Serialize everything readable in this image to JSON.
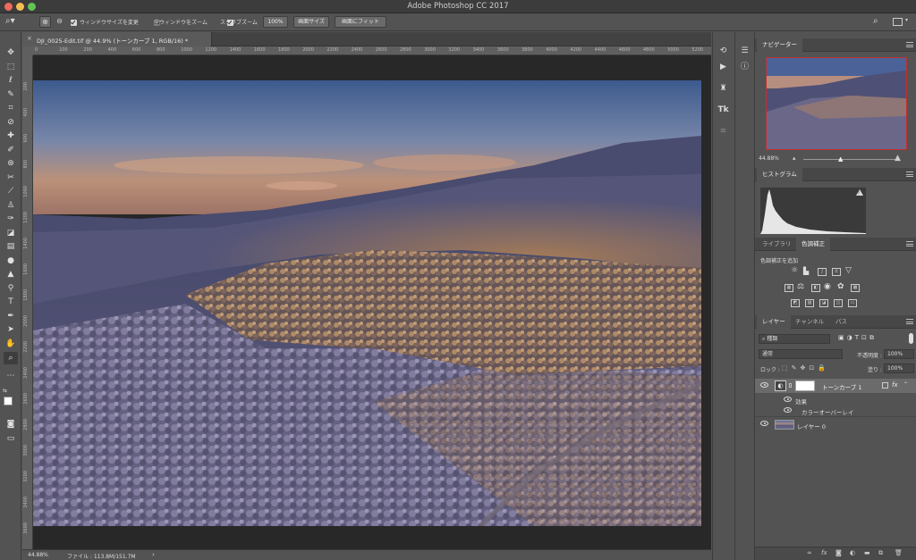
{
  "app": {
    "title": "Adobe Photoshop CC 2017"
  },
  "options_bar": {
    "resize_windows_label": "ウィンドウサイズを変更",
    "zoom_all_label": "全ウィンドウをズーム",
    "scrubby_zoom_label": "スクラブズーム",
    "zoom_100_button": "100%",
    "fit_screen_button": "画面サイズ",
    "fill_screen_button": "画面にフィット"
  },
  "document": {
    "tab_title": "DJI_0025-Edit.tif @ 44.9% (トーンカーブ 1, RGB/16) *",
    "close_symbol": "×"
  },
  "ruler": {
    "top_ticks": [
      "0",
      "100",
      "200",
      "400",
      "600",
      "800",
      "1000",
      "1200",
      "1400",
      "1600",
      "1800",
      "2000",
      "2200",
      "2400",
      "2600",
      "2800",
      "3000",
      "3200",
      "3400",
      "3600",
      "3800",
      "4000",
      "4200",
      "4400",
      "4600",
      "4800",
      "5000",
      "5200"
    ],
    "left_ticks": [
      "200",
      "400",
      "600",
      "800",
      "1000",
      "1200",
      "1400",
      "1600",
      "1800",
      "2000",
      "2200",
      "2400",
      "2600",
      "2800",
      "3000",
      "3200",
      "3400",
      "3600"
    ]
  },
  "status": {
    "zoom": "44.88%",
    "file_info": "ファイル : 113.8M/151.7M",
    "arrow": "›"
  },
  "navigator": {
    "tab": "ナビゲーター",
    "zoom": "44.88%",
    "zoom_fraction": 0.4488
  },
  "histogram": {
    "tab": "ヒストグラム",
    "warning": "!"
  },
  "adjustments": {
    "tab_library": "ライブラリ",
    "tab_adjustments": "色調補正",
    "add_label": "色調補正を追加"
  },
  "layers": {
    "tab_layers": "レイヤー",
    "tab_channels": "チャンネル",
    "tab_paths": "パス",
    "filter_kind": "種類",
    "blend_mode": "通常",
    "opacity_label": "不透明度 :",
    "opacity_value": "100%",
    "lock_label": "ロック :",
    "fill_label": "塗り :",
    "fill_value": "100%",
    "items": [
      {
        "name": "トーンカーブ 1",
        "fx": "fx"
      },
      {
        "effects_label": "効果"
      },
      {
        "effect_name": "カラーオーバーレイ"
      },
      {
        "name": "レイヤー 0"
      }
    ]
  },
  "colors": {
    "accent": "#3c3c3c",
    "panel": "#535353",
    "close_red": "#ed6a5e",
    "min_yellow": "#f5bf4f",
    "max_green": "#61c554"
  }
}
